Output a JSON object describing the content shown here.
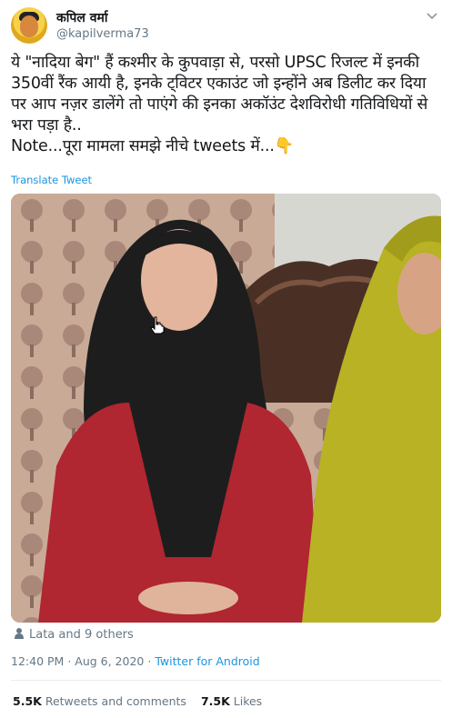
{
  "author": {
    "name": "कपिल वर्मा",
    "handle": "@kapilverma73"
  },
  "tweet": {
    "text": "ये \"नादिया बेग\" हैं कश्मीर के कुपवाड़ा से, परसो UPSC रिजल्ट में इनकी 350वीं रैंक आयी है, इनके ट्विटर एकाउंट जो इन्होंने अब डिलीट कर दिया पर आप नज़र डालेंगे तो पाएंगे की इनका अकॉउंट देशविरोधी गतिविधियों से भरा पड़ा है..\nNote...पूरा मामला समझे नीचे tweets में...👇",
    "translate_label": "Translate Tweet"
  },
  "likers": {
    "text": "Lata and 9 others"
  },
  "meta": {
    "time": "12:40 PM",
    "date": "Aug 6, 2020",
    "separator": "·",
    "source": "Twitter for Android"
  },
  "stats": {
    "retweets_count": "5.5K",
    "retweets_label": "Retweets and comments",
    "likes_count": "7.5K",
    "likes_label": "Likes"
  },
  "icons": {
    "caret": "chevron-down-icon",
    "likers": "person-icon",
    "cursor": "hand-cursor-icon"
  },
  "colors": {
    "link": "#1b95e0",
    "secondary_text": "#657786",
    "primary_text": "#14171a",
    "divider": "#e6ecf0"
  }
}
